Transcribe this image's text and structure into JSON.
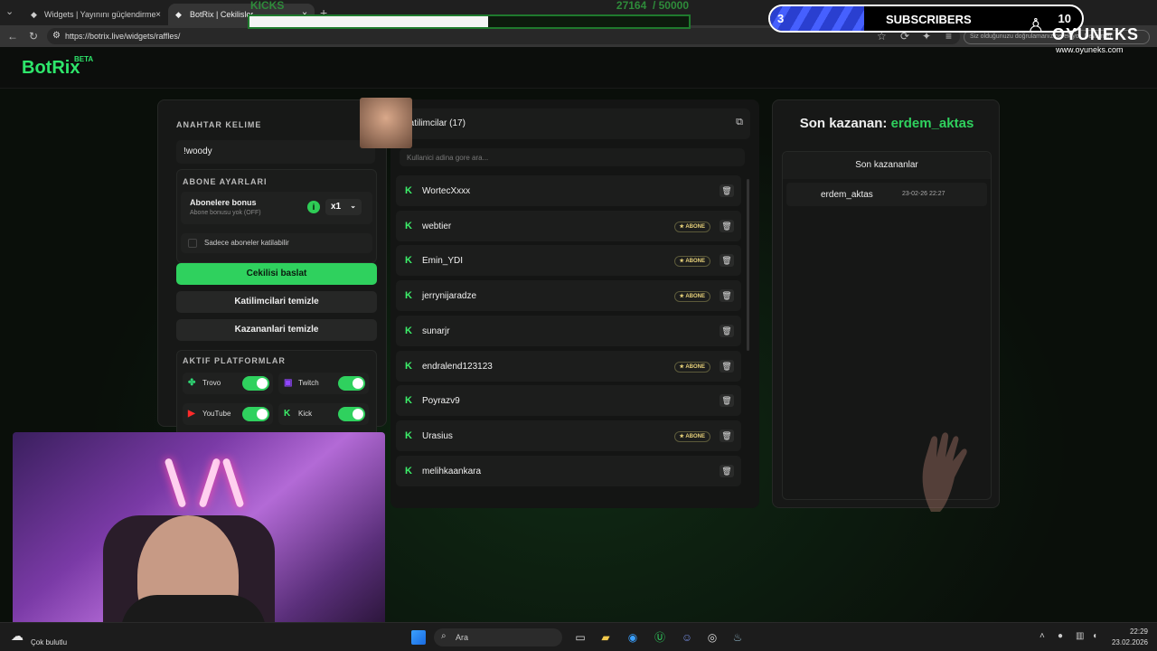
{
  "browser": {
    "tabs": [
      {
        "label": "Widgets | Yayınını güçlendirmek iç"
      },
      {
        "label": "BotRix | Cekilisler"
      }
    ],
    "url": "https://botrix.live/widgets/raffles/",
    "extension_text": "Siz olduğunuzu doğrulamanız gerekiyor. Devam et"
  },
  "overlays": {
    "kicks": {
      "label": "KICKS",
      "current": "27164",
      "goal": "/ 50000",
      "progress": 0.543
    },
    "subscribers": {
      "current": "3",
      "label": "SUBSCRIBERS",
      "goal": "10",
      "progress": 0.3
    },
    "oyuneks": {
      "name": "OYUNEKS",
      "site": "www.oyuneks.com"
    }
  },
  "header": {
    "brand": "BotRix",
    "badge": "BETA"
  },
  "left_panel": {
    "keyword_title": "ANAHTAR KELIME",
    "keyword_value": "!woody",
    "sub_settings_title": "ABONE AYARLARI",
    "bonus_title": "Abonelere bonus",
    "bonus_status": "Abone bonusu yok (OFF)",
    "info_icon": "i",
    "multiplier": "x1",
    "only_subs_label": "Sadece aboneler katilabilir",
    "start_button": "Cekilisi baslat",
    "clear_participants": "Katilimcilari temizle",
    "clear_winners": "Kazananlari temizle",
    "platforms_title": "AKTIF PLATFORMLAR",
    "platforms": [
      {
        "name": "Trovo",
        "icon": "trovo-icon",
        "on": true
      },
      {
        "name": "Twitch",
        "icon": "twitch-icon",
        "on": true
      },
      {
        "name": "YouTube",
        "icon": "youtube-icon",
        "on": true
      },
      {
        "name": "Kick",
        "icon": "kick-icon",
        "on": true
      }
    ]
  },
  "participants": {
    "title": "Katilimcilar (17)",
    "search_placeholder": "Kullanici adina gore ara...",
    "badge_label": "ABONE",
    "rows": [
      {
        "name": "WortecXxxx",
        "sub": false
      },
      {
        "name": "webtier",
        "sub": true
      },
      {
        "name": "Emin_YDI",
        "sub": true
      },
      {
        "name": "jerrynijaradze",
        "sub": true
      },
      {
        "name": "sunarjr",
        "sub": false
      },
      {
        "name": "endralend123123",
        "sub": true
      },
      {
        "name": "Poyrazv9",
        "sub": false
      },
      {
        "name": "Urasius",
        "sub": true
      },
      {
        "name": "melihkaankara",
        "sub": false
      }
    ]
  },
  "winners": {
    "heading_prefix": "Son kazanan:",
    "heading_name": "erdem_aktas",
    "list_title": "Son kazananlar",
    "rows": [
      {
        "name": "erdem_aktas",
        "date": "23-02-26 22:27"
      }
    ]
  },
  "taskbar": {
    "weather": "Çok bulutlu",
    "search": "Ara",
    "time": "22:29",
    "date": "23.02.2026"
  },
  "colors": {
    "accent": "#2fd15e",
    "kick_green": "#3cf06a",
    "subs_blue": "#4660ff"
  }
}
